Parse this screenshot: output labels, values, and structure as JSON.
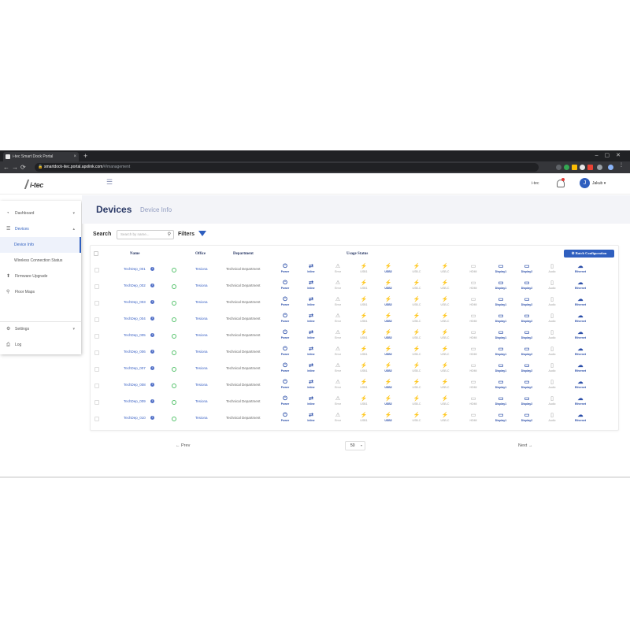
{
  "browser": {
    "tab_title": "i-tec Smart Dock Portal",
    "url_host": "smartdock-itec.portal.apolink.com",
    "url_path": "/#/management",
    "new_tab_glyph": "+",
    "window_controls": "–▢✕"
  },
  "header": {
    "logo": "i-tec",
    "account": "i-tec",
    "user_initial": "J",
    "username": "Jakub"
  },
  "sidebar": {
    "items": [
      {
        "label": "Dashboard",
        "icon": "dashboard-icon"
      },
      {
        "label": "Devices",
        "icon": "devices-icon"
      },
      {
        "label": "Device Info",
        "icon": ""
      },
      {
        "label": "Wireless Connection Status",
        "icon": ""
      },
      {
        "label": "Firmware Upgrade",
        "icon": "firmware-icon"
      },
      {
        "label": "Floor Maps",
        "icon": "map-icon"
      }
    ],
    "settings": "Settings",
    "log": "Log"
  },
  "page": {
    "title": "Devices",
    "subtitle": "Device Info",
    "search_label": "Search",
    "search_placeholder": "Search by name...",
    "filters_label": "Filters"
  },
  "table": {
    "headers": {
      "name": "Name",
      "office": "Office",
      "department": "Department",
      "usage": "Usage Status"
    },
    "batch_button": "Batch Configuration",
    "status_columns": [
      {
        "label": "Power",
        "glyph": "⏻",
        "active": true
      },
      {
        "label": "Inline",
        "glyph": "⇄",
        "active": true
      },
      {
        "label": "Error",
        "glyph": "⚠",
        "active": false
      },
      {
        "label": "USB1",
        "glyph": "⚡",
        "active": false
      },
      {
        "label": "USB2",
        "glyph": "⚡",
        "active": true
      },
      {
        "label": "USB-C",
        "glyph": "⚡",
        "active": false
      },
      {
        "label": "USB-C",
        "glyph": "⚡",
        "active": false
      },
      {
        "label": "HDMI",
        "glyph": "▭",
        "active": false
      },
      {
        "label": "Display1",
        "glyph": "▭",
        "active": true
      },
      {
        "label": "Display2",
        "glyph": "▭",
        "active": true
      },
      {
        "label": "Audio",
        "glyph": "▯",
        "active": false
      },
      {
        "label": "Ethernet",
        "glyph": "☁",
        "active": true
      }
    ],
    "rows": [
      {
        "name": "TechDep_001",
        "office": "Tesiona",
        "department": "Technical Department"
      },
      {
        "name": "TechDep_002",
        "office": "Tesiona",
        "department": "Technical Department"
      },
      {
        "name": "TechDep_003",
        "office": "Tesiona",
        "department": "Technical Department"
      },
      {
        "name": "TechDep_004",
        "office": "Tesiona",
        "department": "Technical Department"
      },
      {
        "name": "TechDep_005",
        "office": "Tesiona",
        "department": "Technical Department"
      },
      {
        "name": "TechDep_006",
        "office": "Tesiona",
        "department": "Technical Department"
      },
      {
        "name": "TechDep_007",
        "office": "Tesiona",
        "department": "Technical Department"
      },
      {
        "name": "TechDep_008",
        "office": "Tesiona",
        "department": "Technical Department"
      },
      {
        "name": "TechDep_009",
        "office": "Tesiona",
        "department": "Technical Department"
      },
      {
        "name": "TechDep_010",
        "office": "Tesiona",
        "department": "Technical Department"
      }
    ]
  },
  "pagination": {
    "prev": "← Prev",
    "next": "Next →",
    "page_size": "50"
  },
  "colors": {
    "accent": "#2f5fbf",
    "title": "#2b3a67",
    "online": "#54c26b"
  }
}
